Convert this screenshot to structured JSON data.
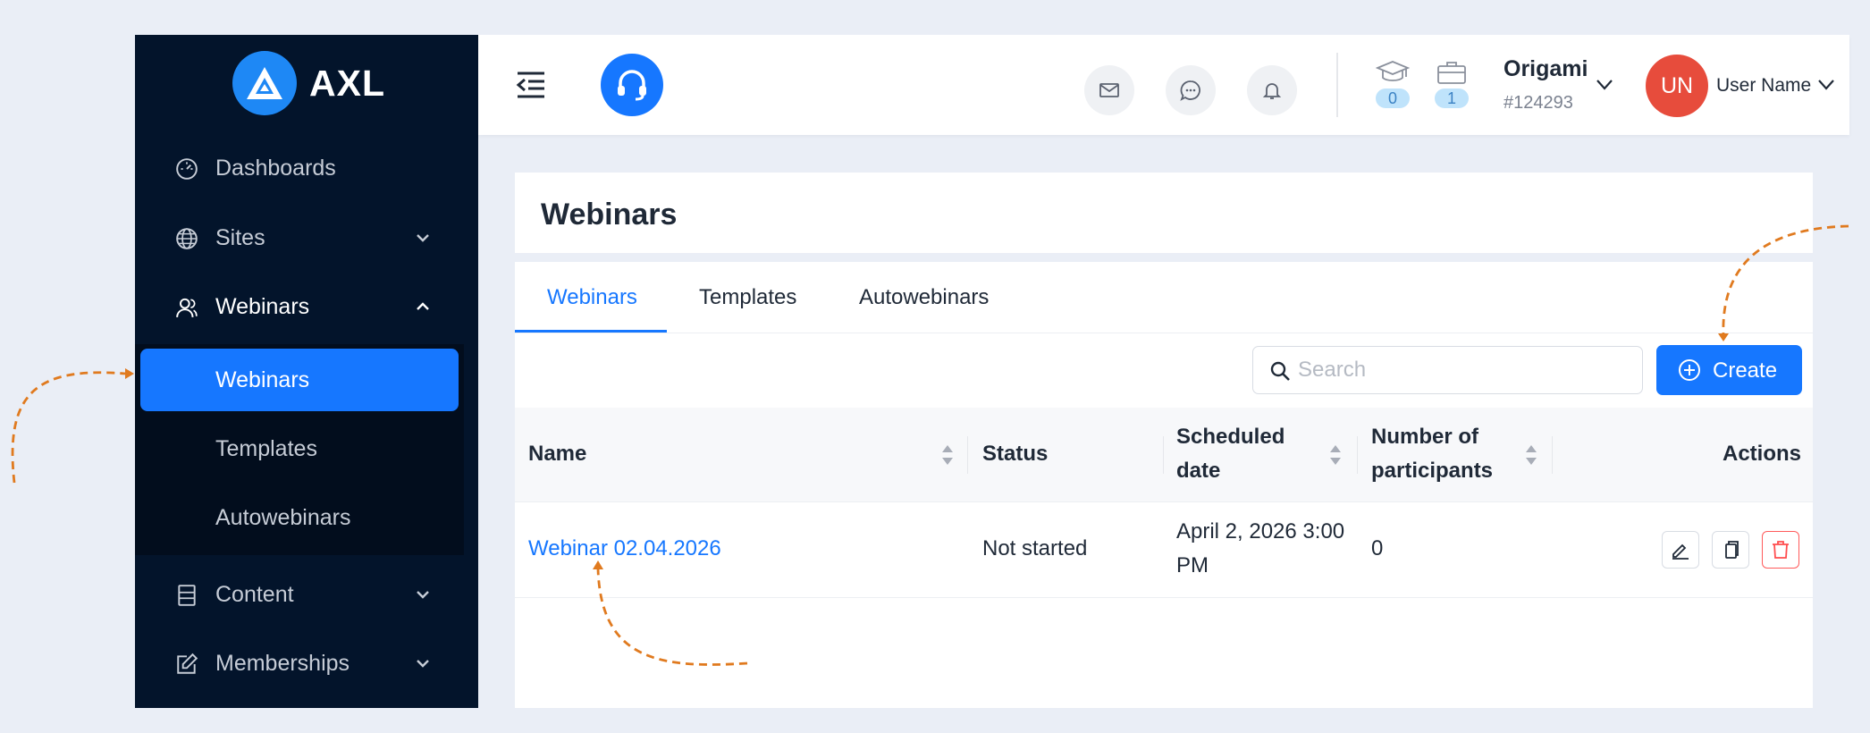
{
  "brand": {
    "name": "AXL",
    "accent": "#1677ff",
    "sidebar_bg": "#03142b"
  },
  "sidebar": {
    "items": [
      {
        "label": "Dashboards",
        "icon": "dashboard-icon"
      },
      {
        "label": "Sites",
        "icon": "globe-icon",
        "expandable": true
      },
      {
        "label": "Webinars",
        "icon": "users-icon",
        "expandable": true,
        "expanded": true
      },
      {
        "label": "Content",
        "icon": "document-icon",
        "expandable": true
      },
      {
        "label": "Memberships",
        "icon": "edit-icon",
        "expandable": true
      }
    ],
    "submenu": [
      {
        "label": "Webinars",
        "active": true
      },
      {
        "label": "Templates"
      },
      {
        "label": "Autowebinars"
      }
    ]
  },
  "header": {
    "icons": [
      "menu-collapse-icon",
      "headset-icon",
      "mail-icon",
      "chat-icon",
      "bell-icon",
      "graduation-cap-icon",
      "briefcase-icon"
    ],
    "courses_count": "0",
    "jobs_count": "1",
    "org": {
      "name": "Origami",
      "id": "#124293"
    },
    "user": {
      "initials": "UN",
      "name": "User Name",
      "avatar_color": "#e74c3c"
    }
  },
  "page": {
    "title": "Webinars"
  },
  "tabs": [
    {
      "label": "Webinars",
      "active": true
    },
    {
      "label": "Templates"
    },
    {
      "label": "Autowebinars"
    }
  ],
  "toolbar": {
    "search_placeholder": "Search",
    "create_label": "Create"
  },
  "table": {
    "columns": [
      {
        "line1": "Name",
        "line2": ""
      },
      {
        "line1": "Status",
        "line2": ""
      },
      {
        "line1": "Scheduled",
        "line2": "date"
      },
      {
        "line1": "Number of",
        "line2": "participants"
      },
      {
        "line1": "Actions",
        "line2": ""
      }
    ],
    "rows": [
      {
        "name": "Webinar 02.04.2026",
        "status": "Not started",
        "date_line1": "April 2, 2026 3:00",
        "date_line2": "PM",
        "participants": "0"
      }
    ]
  }
}
